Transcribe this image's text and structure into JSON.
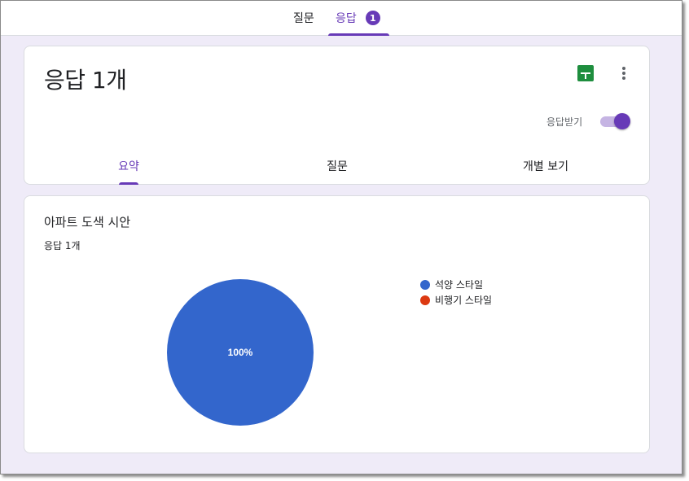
{
  "top_tabs": {
    "questions_label": "질문",
    "responses_label": "응답",
    "responses_badge": "1"
  },
  "header": {
    "title": "응답 1개",
    "sheets_icon": "google-sheets-icon",
    "more_icon": "more-vert-icon",
    "accepting_label": "응답받기",
    "accepting_on": true
  },
  "sub_tabs": {
    "summary": "요약",
    "question": "질문",
    "individual": "개별 보기"
  },
  "summary": {
    "question_title": "아파트 도색 시안",
    "response_count": "응답 1개"
  },
  "colors": {
    "accent": "#673ab7",
    "sheets_green": "#1e8e3e",
    "series_1": "#3366cc",
    "series_2": "#dc3912"
  },
  "chart_data": {
    "type": "pie",
    "labels": [
      "석양 스타일",
      "비행기 스타일"
    ],
    "values": [
      1,
      0
    ],
    "colors": [
      "#3366cc",
      "#dc3912"
    ],
    "slice_labels": [
      "100%"
    ],
    "legend_position": "right"
  }
}
